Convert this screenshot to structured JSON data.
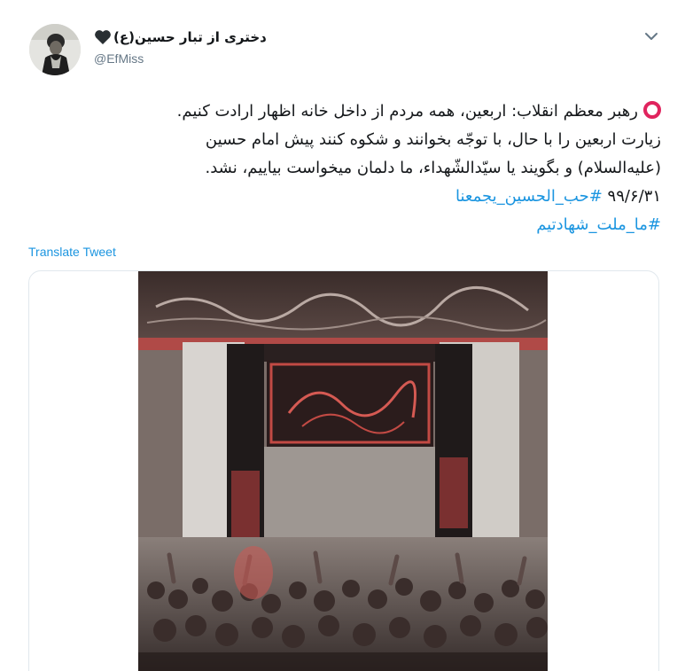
{
  "author": {
    "display_name": "دختری از تبار حسین(ع)",
    "handle": "@EfMiss",
    "avatar_icon": "profile-photo"
  },
  "menu": {
    "icon": "chevron-down-icon"
  },
  "tweet": {
    "lines": [
      "رهبر معظم انقلاب: اربعین، همه مردم از داخل خانه اظهار ارادت کنیم.",
      "زیارت اربعین را با حال، با توجّه بخوانند و شکوه کنند پیش امام حسین",
      "(علیه‌السلام) و بگویند یا سیّدالشّهداء، ما دلمان میخواست بیاییم، نشد."
    ],
    "date_text": "۹۹/۶/۳۱",
    "hashtags": [
      "#حب_الحسین_یجمعنا",
      "#ما_ملت_شهادتیم"
    ],
    "translate_label": "Translate Tweet"
  },
  "media": {
    "type": "photo",
    "caption_in_image": "السلام علیک یا اباعبدالله"
  },
  "colors": {
    "link": "#1b95e0",
    "ring": "#e0245e",
    "text": "#14171a",
    "muted": "#657786",
    "border": "#e1e8ed"
  }
}
